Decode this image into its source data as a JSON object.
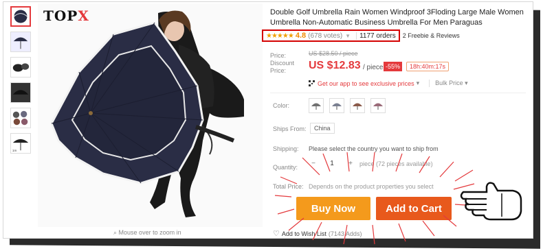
{
  "brand_logo": {
    "main": "TOP",
    "accent": "X"
  },
  "thumbnails": [
    {
      "name": "umbrella-open",
      "active": true
    },
    {
      "name": "umbrella-rain"
    },
    {
      "name": "umbrella-top"
    },
    {
      "name": "umbrella-dark"
    },
    {
      "name": "umbrella-colors"
    },
    {
      "name": "umbrella-size"
    }
  ],
  "image": {
    "zoom_hint": "Mouse over to zoom in"
  },
  "product": {
    "title": "Double Golf Umbrella Rain Women Windproof 3Floding Large Male Women Umbrella Non-Automatic Business Umbrella For Men Paraguas",
    "rating": {
      "stars": "★★★★★",
      "value": "4.8",
      "votes": "(678 votes)"
    },
    "orders": "1177 orders",
    "freebie": "2 Freebie & Reviews"
  },
  "price": {
    "label": "Price:",
    "original": "US $28.50 / piece",
    "discount_label": "Discount Price:",
    "discount": "US $12.83",
    "per": "/ piece",
    "badge": "-55%",
    "timer": "18h:40m:17s",
    "app_offer": "Get our app to see exclusive prices",
    "app_caret": "▾",
    "bulk": "Bulk Price ▾"
  },
  "specs": {
    "color_label": "Color:",
    "ships_label": "Ships From:",
    "ships_value": "China",
    "shipping_label": "Shipping:",
    "shipping_value": "Please select the country you want to ship from",
    "quantity_label": "Quantity:",
    "quantity_value": "1",
    "quantity_minus": "−",
    "quantity_plus": "+",
    "quantity_available": "piece (72 pieces available)",
    "total_label": "Total Price:",
    "total_value": "Depends on the product properties you select"
  },
  "actions": {
    "buy_now": "Buy Now",
    "add_to_cart": "Add to Cart",
    "wishlist": "Add to Wish List",
    "wishlist_count": "(7143 Adds)"
  },
  "colors": {
    "accent_red": "#e4393c",
    "buy_now": "#f49a1c",
    "add_cart": "#e8591c",
    "umbrella": "#2a2d45"
  }
}
